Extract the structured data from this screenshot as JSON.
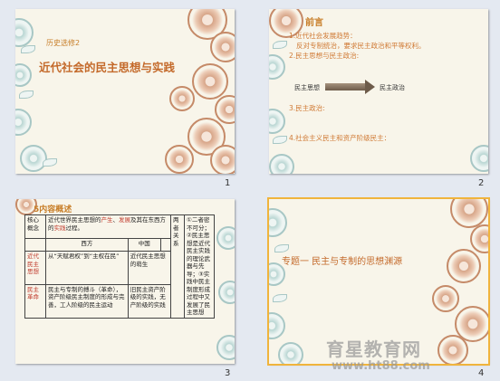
{
  "slides": [
    {
      "number": "1",
      "subtitle": "历史选修2",
      "title": "近代社会的民主思想与实践"
    },
    {
      "number": "2",
      "title": "前言",
      "items": [
        {
          "label": "1.近代社会发展趋势：",
          "detail": "反对专制统治，要求民主政治和平等权利。"
        },
        {
          "label": "2.民主思想与民主政治:"
        },
        {
          "label": "3.民主政治:"
        },
        {
          "label": "4.社会主义民主和资产阶级民主："
        }
      ],
      "diagram": {
        "left": "民主思想",
        "right": "民主政治"
      }
    },
    {
      "number": "3",
      "title": "5内容概述",
      "table": {
        "core_label": "核心概念",
        "core_text_a": "近代世界民主思想的",
        "core_highlight1": "产生",
        "core_text_b": "、",
        "core_highlight2": "发展",
        "core_text_c": "及其在东西方的",
        "core_highlight3": "实践",
        "core_text_d": "过程。",
        "col_west": "西方",
        "col_china": "中国",
        "row1_label": "近代民主思想",
        "row1_west": "从“天赋君权”到“主权在民”",
        "row1_china": "近代民主思想的萌生",
        "row2_label": "民主革命",
        "row2_west": "民主与专制的搏斗（革命），资产阶级民主制度的形成与完善，工人阶级的民主运动",
        "row2_china": "旧民主资产阶级的实践，无产阶级的实践",
        "relation_label": "两者关系",
        "relation_text": "①二者密不可分；②民主思想是近代民主实践的理论武器与先导；③实践中民主制度形成过程中又发展了民主思想"
      }
    },
    {
      "number": "4",
      "title": "专题一 民主与专制的思想渊源"
    }
  ],
  "watermark": {
    "brand": "育星教育网",
    "url": "www.ht88.com"
  }
}
